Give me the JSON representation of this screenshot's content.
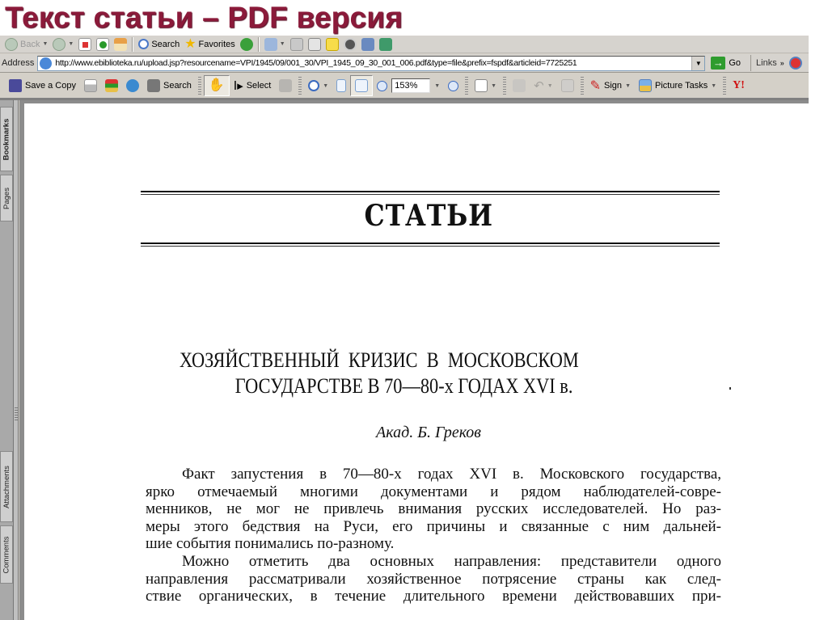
{
  "slide": {
    "title": "Текст статьи – PDF версия",
    "title_color": "#8b1a3a"
  },
  "ie_toolbar": {
    "back_label": "Back",
    "search_label": "Search",
    "favorites_label": "Favorites",
    "icons": [
      "back-icon",
      "forward-icon",
      "stop-icon",
      "refresh-icon",
      "home-icon",
      "search-icon",
      "favorites-star-icon",
      "media-icon",
      "mail-icon",
      "print-icon",
      "edit-icon",
      "discuss-icon",
      "research-icon",
      "messenger-icon",
      "tools-icon"
    ]
  },
  "address_bar": {
    "label": "Address",
    "url": "http://www.ebiblioteka.ru/upload.jsp?resourcename=VPI/1945/09/001_30/VPI_1945_09_30_001_006.pdf&type=file&prefix=fspdf&articleid=7725251",
    "go_label": "Go",
    "links_label": "Links"
  },
  "acrobat_toolbar": {
    "save_copy_label": "Save a Copy",
    "search_label": "Search",
    "select_label": "Select",
    "zoom_value": "153%",
    "sign_label": "Sign",
    "picture_tasks_label": "Picture Tasks",
    "yahoo_label": "Y!"
  },
  "nav_pane": {
    "tabs": [
      "Bookmarks",
      "Pages",
      "Attachments",
      "Comments"
    ],
    "active_tab": "Bookmarks"
  },
  "document": {
    "section_title": "СТАТЬИ",
    "article_title_line1": "ХОЗЯЙСТВЕННЫЙ  КРИЗИС  В  МОСКОВСКОМ",
    "article_title_line2": "ГОСУДАРСТВЕ В 70—80-х ГОДАХ XVI в.",
    "author": "Акад. Б. Греков",
    "body_lines": [
      "Факт запустения в 70—80-х годах XVI в. Московского государства,",
      "ярко отмечаемый многими документами и рядом наблюдателей-совре-",
      "менников, не мог не привлечь внимания русских исследователей. Но раз-",
      "меры этого бедствия на Руси, его причины и связанные с ним дальней-",
      "шие события понимались по-разному.",
      "Можно отметить два основных направления: представители одного",
      "направления рассматривали хозяйственное потрясение страны как след-",
      "ствие органических, в течение длительного времени действовавших при-"
    ]
  }
}
